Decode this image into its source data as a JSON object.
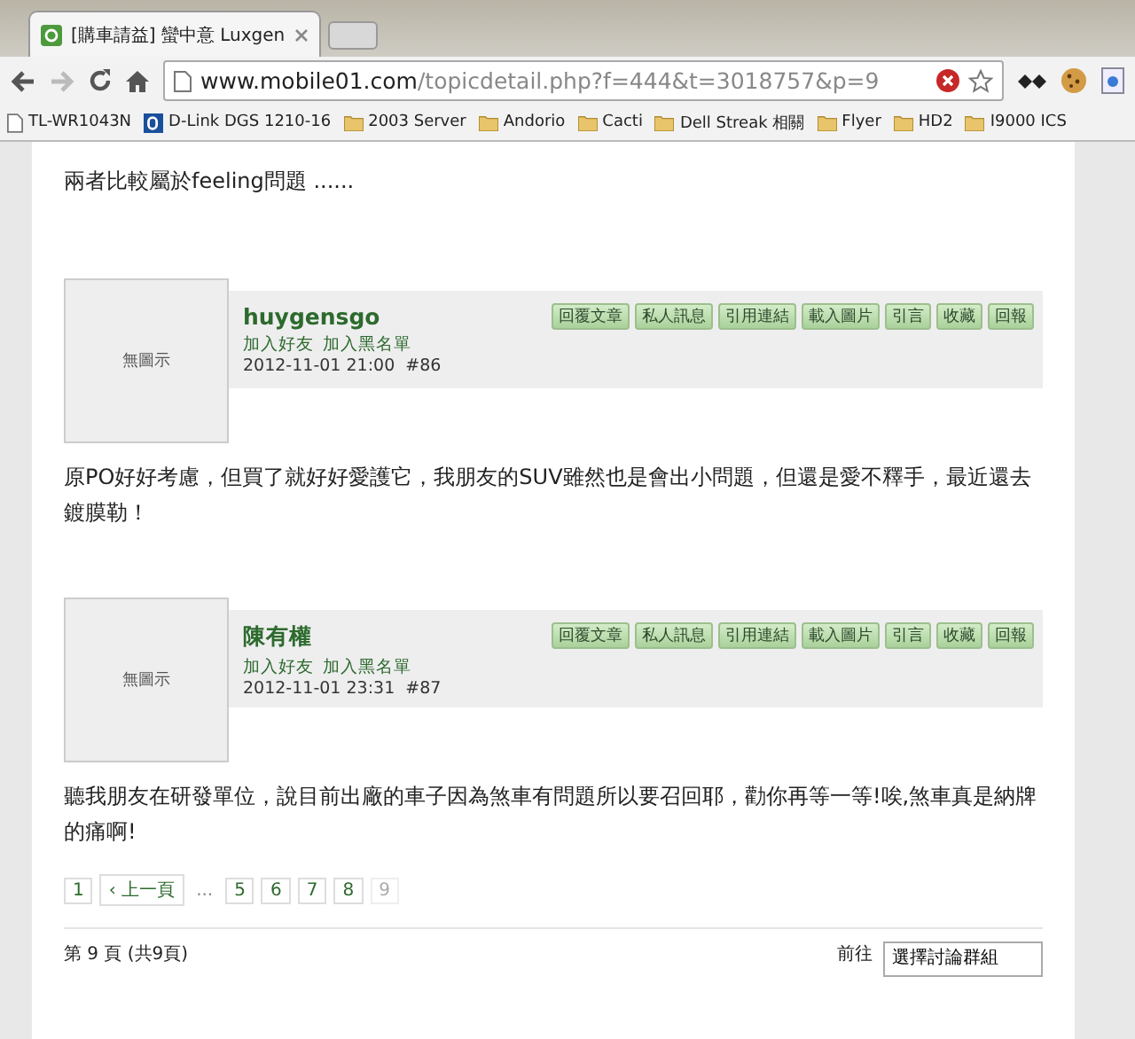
{
  "browser": {
    "tab_title": "[購車請益] 蠻中意 Luxgen",
    "url_host": "www.mobile01.com",
    "url_path": "/topicdetail.php?f=444&t=3018757&p=9",
    "bookmarks": [
      {
        "label": "TL-WR1043N",
        "kind": "page"
      },
      {
        "label": "D-Link DGS 1210-16",
        "kind": "dlink"
      },
      {
        "label": "2003 Server",
        "kind": "folder"
      },
      {
        "label": "Andorio",
        "kind": "folder"
      },
      {
        "label": "Cacti",
        "kind": "folder"
      },
      {
        "label": "Dell Streak 相關",
        "kind": "folder"
      },
      {
        "label": "Flyer",
        "kind": "folder"
      },
      {
        "label": "HD2",
        "kind": "folder"
      },
      {
        "label": "I9000 ICS",
        "kind": "folder"
      }
    ]
  },
  "intro_text": "兩者比較屬於feeling問題 ......",
  "posts": [
    {
      "avatar_text": "無圖示",
      "author": "huygensgo",
      "links": [
        "加入好友",
        "加入黑名單"
      ],
      "meta": "2012-11-01 21:00  #86",
      "actions": [
        "回覆文章",
        "私人訊息",
        "引用連結",
        "載入圖片",
        "引言",
        "收藏",
        "回報"
      ],
      "body": "原PO好好考慮，但買了就好好愛護它，我朋友的SUV雖然也是會出小問題，但還是愛不釋手，最近還去鍍膜勒！"
    },
    {
      "avatar_text": "無圖示",
      "author": "陳有權",
      "links": [
        "加入好友",
        "加入黑名單"
      ],
      "meta": "2012-11-01 23:31  #87",
      "actions": [
        "回覆文章",
        "私人訊息",
        "引用連結",
        "載入圖片",
        "引言",
        "收藏",
        "回報"
      ],
      "body": "聽我朋友在研發單位，說目前出廠的車子因為煞車有問題所以要召回耶，勸你再等一等!唉,煞車真是納牌的痛啊!"
    }
  ],
  "pagination": [
    {
      "label": "1",
      "kind": "page",
      "selected": false
    },
    {
      "label": "‹ 上一頁",
      "kind": "page",
      "selected": false
    },
    {
      "label": "...",
      "kind": "gap",
      "selected": false
    },
    {
      "label": "5",
      "kind": "page",
      "selected": false
    },
    {
      "label": "6",
      "kind": "page",
      "selected": false
    },
    {
      "label": "7",
      "kind": "page",
      "selected": false
    },
    {
      "label": "8",
      "kind": "page",
      "selected": false
    },
    {
      "label": "9",
      "kind": "page",
      "selected": true
    }
  ],
  "footer": {
    "page_info": "第 9 頁 (共9頁)",
    "goto_label": "前往",
    "goto_select": "選擇討論群組"
  }
}
